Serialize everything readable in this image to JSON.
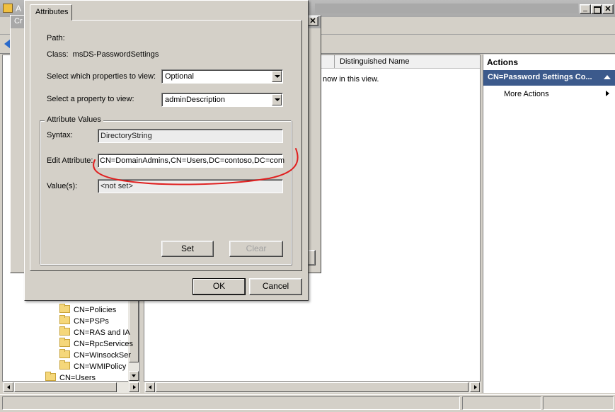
{
  "main_window": {
    "title_bar_fragment": "A",
    "second_dialog_fragment": "Cr"
  },
  "columns": {
    "distinguished_name": "Distinguished Name"
  },
  "list": {
    "empty_message_fragment": "now in this view."
  },
  "actions": {
    "header": "Actions",
    "section": "CN=Password Settings Co...",
    "more_actions": "More Actions"
  },
  "tree": {
    "items": [
      "CN=Policies",
      "CN=PSPs",
      "CN=RAS and IA",
      "CN=RpcServices",
      "CN=WinsockSer",
      "CN=WMIPolicy"
    ],
    "users_item": "CN=Users"
  },
  "dialog": {
    "tab": "Attributes",
    "path_label": "Path:",
    "class_text": "Class:  msDS-PasswordSettings",
    "select_properties_label": "Select which properties to view:",
    "select_properties_value": "Optional",
    "select_property_label": "Select a property to view:",
    "select_property_value": "adminDescription",
    "group_title": "Attribute Values",
    "syntax_label": "Syntax:",
    "syntax_value": "DirectoryString",
    "edit_attribute_label": "Edit Attribute:",
    "edit_attribute_value": "CN=DomainAdmins,CN=Users,DC=contoso,DC=com",
    "values_label": "Value(s):",
    "values_value": "<not set>",
    "set_button": "Set",
    "clear_button": "Clear",
    "ok_button": "OK",
    "cancel_button": "Cancel"
  },
  "colors": {
    "dialog_bg": "#d4d0c8",
    "actions_section_bg": "#3c5a8c",
    "annotation_red": "#e02020"
  }
}
